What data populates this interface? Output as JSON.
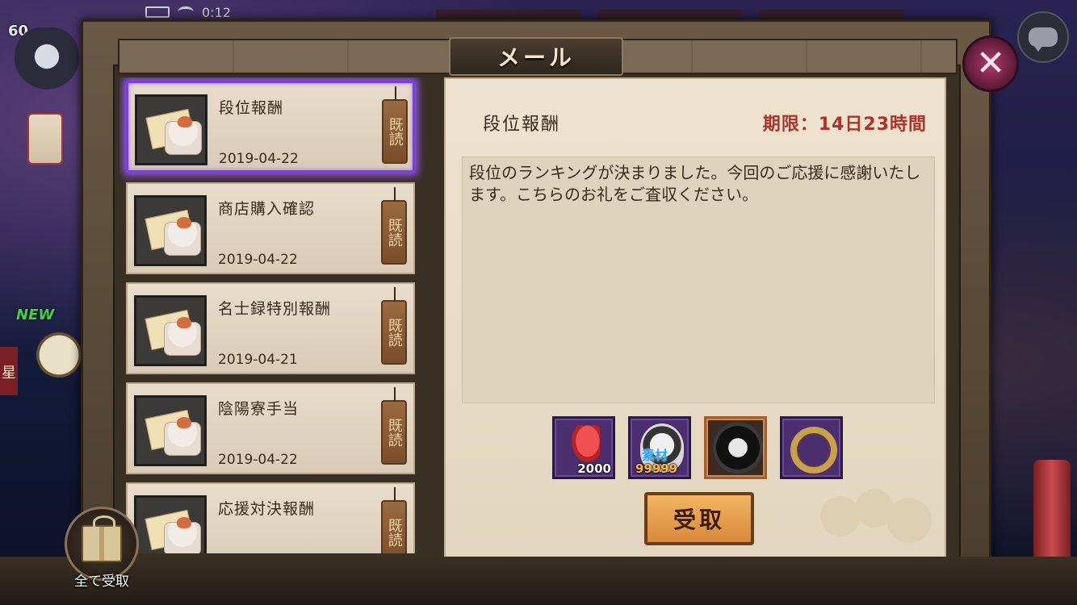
{
  "status": {
    "level": "60",
    "time": "0:12"
  },
  "window": {
    "title": "メール",
    "close_glyph": "✕"
  },
  "background": {
    "new_label": "NEW",
    "side_mark": "星"
  },
  "mail_list": [
    {
      "title": "段位報酬",
      "date": "2019-04-22",
      "tag": "既読",
      "selected": true
    },
    {
      "title": "商店購入確認",
      "date": "2019-04-22",
      "tag": "既読",
      "selected": false
    },
    {
      "title": "名士録特別報酬",
      "date": "2019-04-21",
      "tag": "既読",
      "selected": false
    },
    {
      "title": "陰陽寮手当",
      "date": "2019-04-22",
      "tag": "既読",
      "selected": false
    },
    {
      "title": "応援対決報酬",
      "date": "",
      "tag": "既読",
      "selected": false
    }
  ],
  "detail": {
    "title": "段位報酬",
    "expiry": "期限：14日23時間",
    "body": "段位のランキングが決まりました。今回のご応援に感謝いたします。こちらのお礼をご査収ください。",
    "rewards": [
      {
        "icon": "feather-icon",
        "count": "2000"
      },
      {
        "icon": "material-daruma-icon",
        "label": "素材",
        "count": "99999"
      },
      {
        "icon": "black-daruma-icon",
        "count": ""
      },
      {
        "icon": "ring-icon",
        "count": ""
      }
    ],
    "claim_label": "受取"
  },
  "claim_all": {
    "label": "全て受取"
  },
  "colors": {
    "accent_select": "#7a3cf0",
    "expiry": "#b0312a",
    "button": "#d8883a"
  }
}
